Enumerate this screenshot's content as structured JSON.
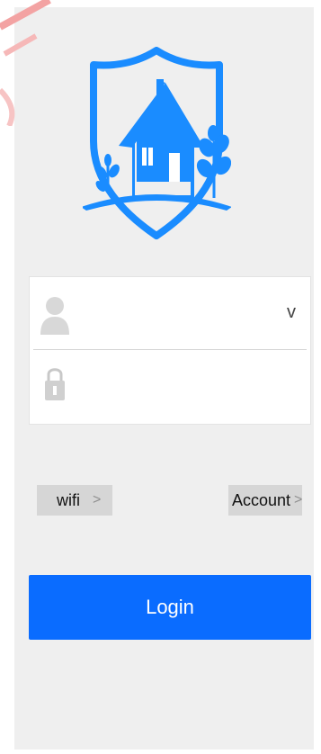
{
  "colors": {
    "brand_blue": "#1a8cff",
    "login_button": "#0a6cff",
    "background": "#efefef"
  },
  "logo": {
    "icon": "house-shield-logo-icon"
  },
  "login_form": {
    "username": {
      "icon": "user-icon",
      "value": "",
      "placeholder": "",
      "dropdown_label": "v"
    },
    "password": {
      "icon": "lock-icon",
      "value": "",
      "placeholder": ""
    }
  },
  "links": {
    "wifi": {
      "label": "wifi",
      "chevron": ">"
    },
    "account": {
      "label": "Account",
      "chevron": ">"
    }
  },
  "login_button": {
    "label": "Login"
  }
}
